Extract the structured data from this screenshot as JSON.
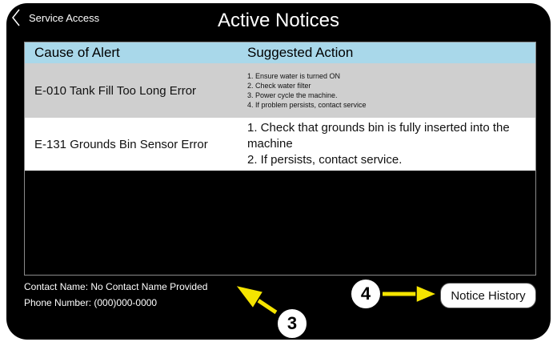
{
  "header": {
    "back_label": "Service Access",
    "title": "Active Notices"
  },
  "table": {
    "columns": [
      "Cause of Alert",
      "Suggested Action"
    ],
    "rows": [
      {
        "cause": "E-010 Tank Fill Too Long Error",
        "actions": [
          "1. Ensure water is turned ON",
          "2. Check water filter",
          "3. Power cycle the machine.",
          "4. If problem persists, contact service"
        ]
      },
      {
        "cause": "E-131 Grounds Bin Sensor Error",
        "actions": [
          "1. Check that grounds bin is fully inserted into the machine",
          "2.  If persists, contact service."
        ]
      }
    ]
  },
  "contact": {
    "name_line": "Contact Name:  No Contact Name Provided",
    "phone_line": "Phone Number: (000)000-0000"
  },
  "notice_history_label": "Notice History",
  "callouts": [
    "3",
    "4"
  ],
  "colors": {
    "header_row": "#a9d8ea",
    "arrow": "#f5e400",
    "row1_bg": "#cfcfcf",
    "screen_bg": "#000000"
  },
  "icons": [
    "chevron-left-icon"
  ]
}
